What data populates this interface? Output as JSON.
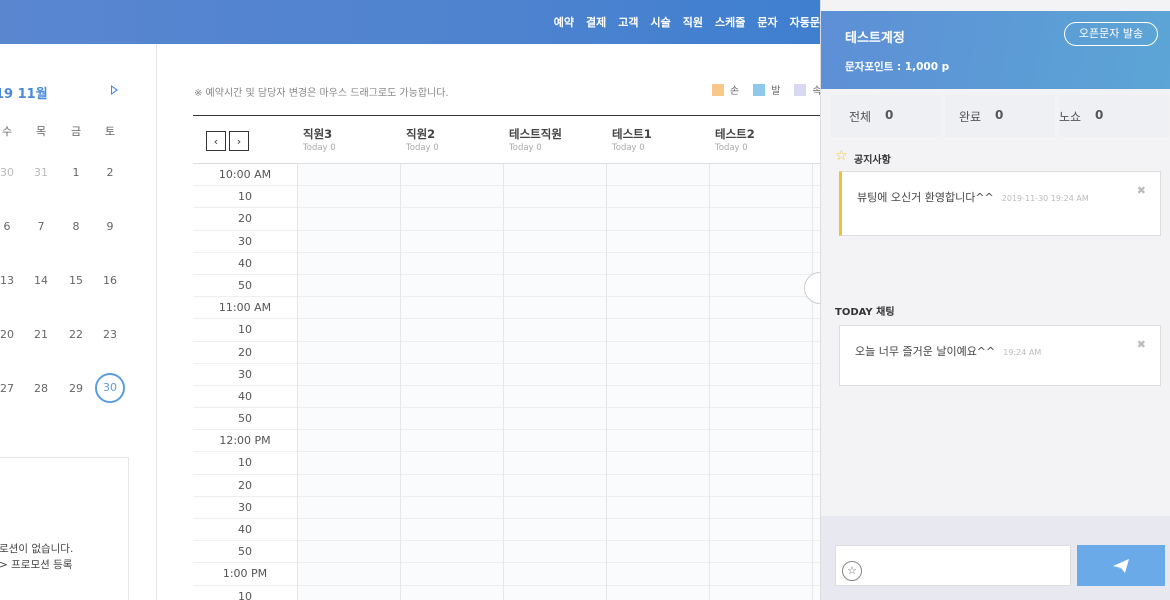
{
  "topnav": {
    "items": [
      "예약",
      "결제",
      "고객",
      "시술",
      "직원",
      "스케줄",
      "문자",
      "자동문"
    ]
  },
  "calendar": {
    "month_label": "19 11월",
    "dow": [
      "수",
      "목",
      "금",
      "토"
    ],
    "weeks": [
      [
        "30",
        "31",
        "1",
        "2"
      ],
      [
        "6",
        "7",
        "8",
        "9"
      ],
      [
        "13",
        "14",
        "15",
        "16"
      ],
      [
        "20",
        "21",
        "22",
        "23"
      ],
      [
        "27",
        "28",
        "29",
        "30"
      ]
    ],
    "today": "30"
  },
  "promo": {
    "line1": "로션이 없습니다.",
    "line2": "> 프로모션 등록"
  },
  "schedule": {
    "notice": "※ 예약시간 및 담당자 변경은 마우스 드래그로도 가능합니다.",
    "legend": [
      {
        "label": "손",
        "color": "#f8c88a"
      },
      {
        "label": "발",
        "color": "#8ec8ea"
      },
      {
        "label": "속",
        "color": "#d8d8f0"
      }
    ],
    "staff": [
      {
        "name": "직원3",
        "sub": "Today 0"
      },
      {
        "name": "직원2",
        "sub": "Today 0"
      },
      {
        "name": "테스트직원",
        "sub": "Today 0"
      },
      {
        "name": "테스트1",
        "sub": "Today 0"
      },
      {
        "name": "테스트2",
        "sub": "Today 0"
      }
    ],
    "times": [
      "10:00 AM",
      "10",
      "20",
      "30",
      "40",
      "50",
      "11:00 AM",
      "10",
      "20",
      "30",
      "40",
      "50",
      "12:00 PM",
      "10",
      "20",
      "30",
      "40",
      "50",
      "1:00 PM",
      "10"
    ]
  },
  "right": {
    "account": "테스트계정",
    "sms_button": "오픈문자 발송",
    "points": "문자포인트 : 1,000 p",
    "stats": [
      {
        "label": "전체",
        "value": "0"
      },
      {
        "label": "완료",
        "value": "0"
      },
      {
        "label": "노쇼",
        "value": "0"
      }
    ],
    "notice_title": "공지사항",
    "notice_text": "뷰팅에 오신거 환영합니다^^",
    "notice_time": "2019-11-30 19:24 AM",
    "chat_title": "TODAY 채팅",
    "chat_text": "오늘 너무 즐거운 날이예요^^",
    "chat_time": "19:24 AM"
  }
}
